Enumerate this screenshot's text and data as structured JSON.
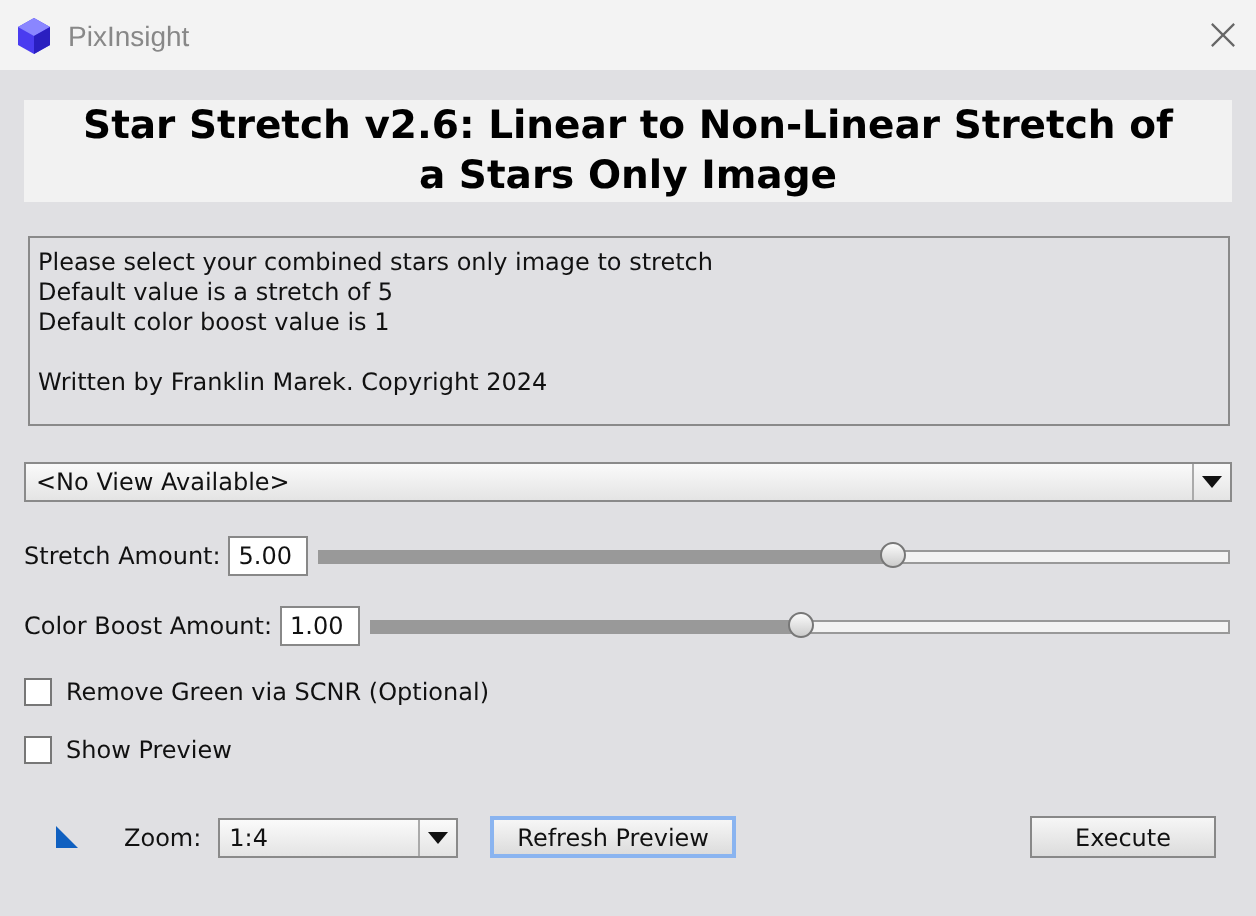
{
  "window": {
    "title": "PixInsight"
  },
  "heading": "Star Stretch v2.6: Linear to Non-Linear Stretch of a Stars Only Image",
  "info": {
    "lines": [
      "Please select your combined stars only image to stretch",
      "Default value is a stretch of 5",
      "Default color boost value is 1"
    ],
    "credit": "Written by Franklin Marek. Copyright 2024"
  },
  "view_select": {
    "value": "<No View Available>"
  },
  "sliders": [
    {
      "label": "Stretch Amount:",
      "value": "5.00",
      "level": 0.63
    },
    {
      "label": "Color Boost Amount:",
      "value": "1.00",
      "level": 0.5
    }
  ],
  "checkboxes": [
    {
      "label": "Remove Green via SCNR (Optional)",
      "checked": false
    },
    {
      "label": "Show Preview",
      "checked": false
    }
  ],
  "zoom": {
    "label": "Zoom:",
    "value": "1:4"
  },
  "buttons": [
    {
      "label": "Refresh Preview",
      "focused": true
    },
    {
      "label": "Execute",
      "focused": false
    }
  ]
}
